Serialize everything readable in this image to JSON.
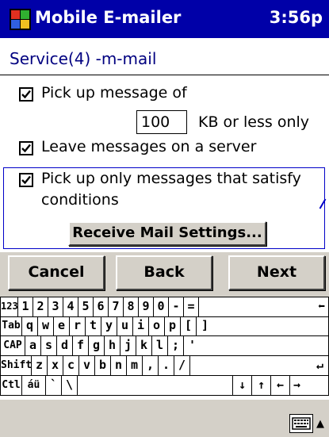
{
  "titlebar": {
    "app_title": "Mobile E-mailer",
    "clock": "3:56p"
  },
  "header": {
    "title": "Service(4) -m-mail"
  },
  "options": {
    "pickup_size_label": "Pick up message of",
    "pickup_size_checked": true,
    "pickup_size_value": "100",
    "pickup_size_suffix": "KB or less only",
    "leave_on_server_label": "Leave messages on a server",
    "leave_on_server_checked": true,
    "conditions_label_line1": "Pick up only messages that satisfy",
    "conditions_label_line2": "conditions",
    "conditions_checked": true,
    "receive_settings_button": "Receive Mail Settings..."
  },
  "nav": {
    "cancel": "Cancel",
    "back": "Back",
    "next": "Next"
  },
  "keyboard": {
    "row1": [
      "123",
      "1",
      "2",
      "3",
      "4",
      "5",
      "6",
      "7",
      "8",
      "9",
      "0",
      "-",
      "=",
      "⬅"
    ],
    "row2": [
      "Tab",
      "q",
      "w",
      "e",
      "r",
      "t",
      "y",
      "u",
      "i",
      "o",
      "p",
      "[",
      "]"
    ],
    "row3": [
      "CAP",
      "a",
      "s",
      "d",
      "f",
      "g",
      "h",
      "j",
      "k",
      "l",
      ";",
      "'"
    ],
    "row4": [
      "Shift",
      "z",
      "x",
      "c",
      "v",
      "b",
      "n",
      "m",
      ",",
      ".",
      "/",
      "↵"
    ],
    "row5": [
      "Ctl",
      "áü",
      "`",
      "\\",
      "",
      "↓",
      "↑",
      "←",
      "→"
    ]
  },
  "colors": {
    "titlebar": "#0000a8",
    "accent_border": "#0000c8",
    "panel": "#d4d0c8"
  },
  "icons": {
    "start": "windows-flag-icon",
    "keyboard": "keyboard-icon",
    "sip_arrow": "up-arrow-icon"
  }
}
